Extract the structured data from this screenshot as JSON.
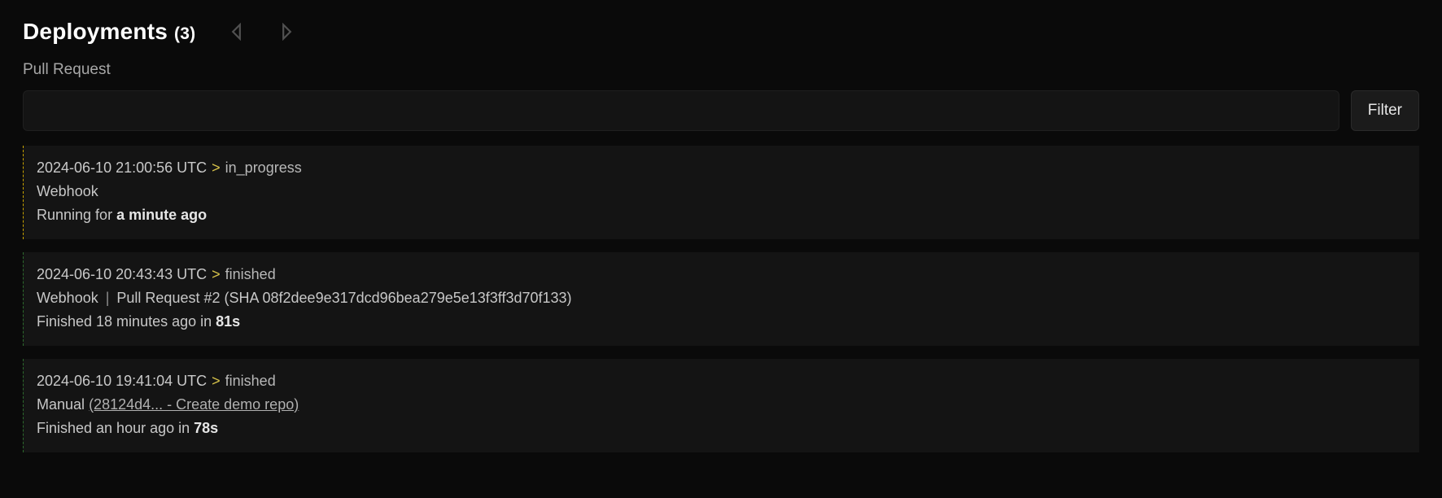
{
  "header": {
    "title": "Deployments",
    "count": "(3)"
  },
  "filter": {
    "label": "Pull Request",
    "value": "",
    "button": "Filter"
  },
  "deployments": [
    {
      "status_kind": "progress",
      "timestamp": "2024-06-10 21:00:56 UTC",
      "state": "in_progress",
      "trigger": "Webhook",
      "has_pr_extra": false,
      "has_commit_link": false,
      "duration_prefix": "Running for ",
      "duration_bold": "a minute ago",
      "duration_suffix": ""
    },
    {
      "status_kind": "done",
      "timestamp": "2024-06-10 20:43:43 UTC",
      "state": "finished",
      "trigger": "Webhook",
      "has_pr_extra": true,
      "pr_extra": "Pull Request #2 (SHA 08f2dee9e317dcd96bea279e5e13f3ff3d70f133)",
      "has_commit_link": false,
      "duration_prefix": "Finished 18 minutes ago in ",
      "duration_bold": "81s",
      "duration_suffix": ""
    },
    {
      "status_kind": "done",
      "timestamp": "2024-06-10 19:41:04 UTC",
      "state": "finished",
      "trigger": "Manual",
      "has_pr_extra": false,
      "has_commit_link": true,
      "commit_link": "(28124d4... - Create demo repo)",
      "duration_prefix": "Finished an hour ago in ",
      "duration_bold": "78s",
      "duration_suffix": ""
    }
  ]
}
